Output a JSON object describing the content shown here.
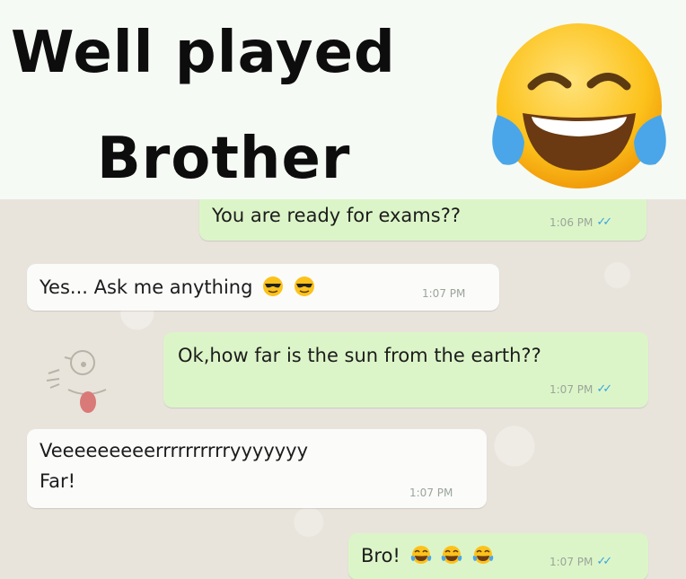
{
  "header": {
    "title_line1": "Well played",
    "title_line2": "Brother"
  },
  "messages": [
    {
      "direction": "out",
      "text": "You are ready for exams??",
      "time": "1:06 PM"
    },
    {
      "direction": "in",
      "text": "Yes... Ask me anything",
      "emojis": [
        "smiling-face-with-sunglasses",
        "smiling-face-with-sunglasses"
      ],
      "time": "1:07 PM"
    },
    {
      "direction": "out",
      "text": "Ok,how far is the sun from the earth??",
      "time": "1:07 PM"
    },
    {
      "direction": "in",
      "text_line1": "Veeeeeeeeerrrrrrrrrryyyyyyy",
      "text_line2": "Far!",
      "time": "1:07 PM"
    },
    {
      "direction": "out",
      "text": "Bro!",
      "emojis": [
        "face-with-tears-of-joy",
        "face-with-tears-of-joy",
        "face-with-tears-of-joy"
      ],
      "time": "1:07 PM"
    }
  ],
  "colors": {
    "outgoing_bubble": "#dcf5c8",
    "incoming_bubble": "#fbfbfa",
    "read_ticks": "#3aa4e0",
    "chat_background": "#e8e4dc"
  }
}
